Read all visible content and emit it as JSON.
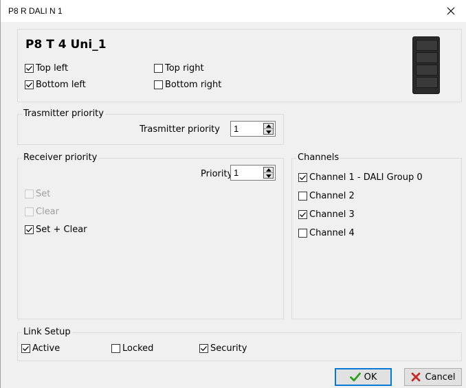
{
  "window": {
    "title": "P8 R DALI N 1",
    "close_icon": "close-icon"
  },
  "device": {
    "name": "P8 T 4 Uni_1",
    "buttons": [
      {
        "label": "Top left",
        "checked": true
      },
      {
        "label": "Top right",
        "checked": false
      },
      {
        "label": "Bottom left",
        "checked": true
      },
      {
        "label": "Bottom right",
        "checked": false
      }
    ]
  },
  "transmitter": {
    "group_label": "Trasmitter priority",
    "field_label": "Trasmitter priority",
    "value": "1"
  },
  "receiver": {
    "group_label": "Receiver priority",
    "field_label": "Priority",
    "value": "1",
    "options": [
      {
        "label": "Set",
        "checked": false,
        "enabled": false
      },
      {
        "label": "Clear",
        "checked": false,
        "enabled": false
      },
      {
        "label": "Set + Clear",
        "checked": true,
        "enabled": true
      }
    ]
  },
  "channels": {
    "group_label": "Channels",
    "items": [
      {
        "label": "Channel 1 - DALI Group 0",
        "checked": true
      },
      {
        "label": "Channel 2",
        "checked": false
      },
      {
        "label": "Channel 3",
        "checked": true
      },
      {
        "label": "Channel 4",
        "checked": false
      }
    ]
  },
  "link_setup": {
    "group_label": "Link Setup",
    "items": [
      {
        "label": "Active",
        "checked": true
      },
      {
        "label": "Locked",
        "checked": false
      },
      {
        "label": "Security",
        "checked": true
      }
    ]
  },
  "buttons": {
    "ok_label": "OK",
    "cancel_label": "Cancel"
  },
  "colors": {
    "ok_check": "#2e9e1f",
    "cancel_x": "#c62828",
    "focus_border": "#0078d7"
  }
}
